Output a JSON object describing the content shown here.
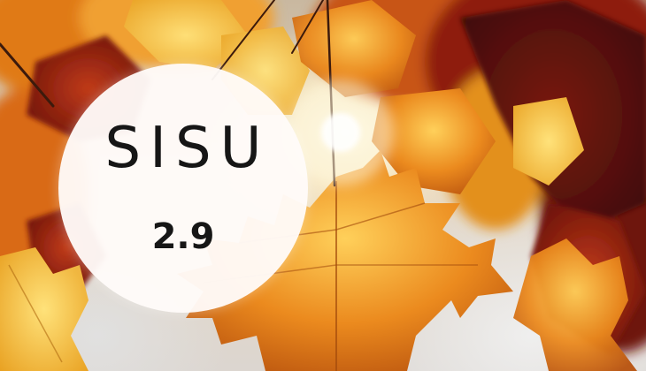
{
  "brand": {
    "title": "SISU",
    "version": "2.9"
  },
  "colors": {
    "circle": "#fffbf9",
    "text": "#161616",
    "leaf_orange": "#e8851a",
    "leaf_red": "#9a1a10",
    "leaf_yellow": "#f2c13a",
    "sunlight": "#fff8dc"
  }
}
